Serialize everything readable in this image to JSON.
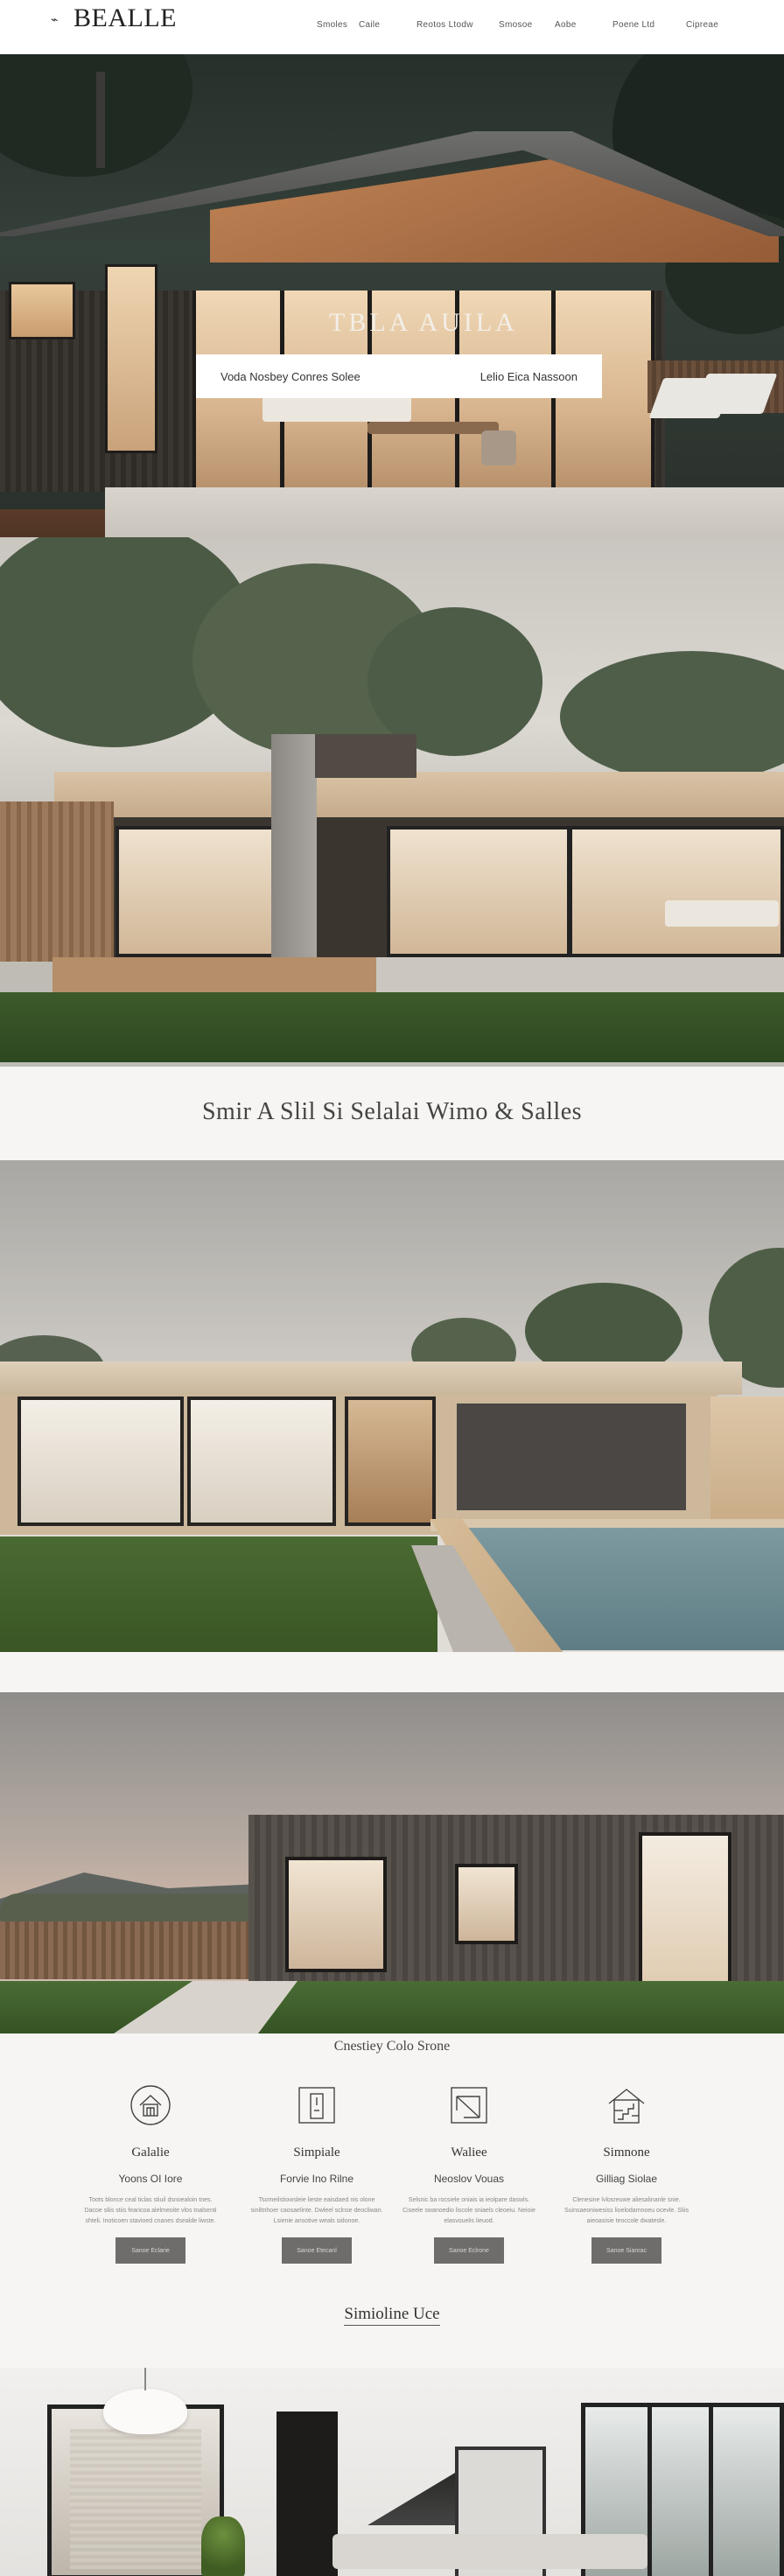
{
  "header": {
    "logo_mark": "⌁",
    "logo": "BEALLE",
    "nav": [
      "Smoles",
      "Caile",
      "Reotos Ltodw",
      "Smosoe",
      "Aobe",
      "Poene Ltd",
      "Cipreae"
    ]
  },
  "hero": {
    "title": "TBLA   AUILA",
    "overlay_left": "Voda  Nosbey Conres Solee",
    "overlay_right": "Lelio Eica Nassoon"
  },
  "tagline": "Smir A Slil Si Selalai Wimo & Salles",
  "features": {
    "title": "Cnestiey Colo Srone",
    "items": [
      {
        "icon": "house-icon",
        "name": "Galalie",
        "subtitle": "Yoons OI Iore",
        "description": "Toots blonce ceal ticlas stiuil dsnoealoin tnes. Dacoe sliis stiis fearicoa alelmeoite vlos tnalsenti shteli. Inoticoen stavioed cnanes dsealde liwste.",
        "button": "Sanoe Eclarie"
      },
      {
        "icon": "door-icon",
        "name": "Simpiale",
        "subtitle": "Forvie Ino Rilne",
        "description": "Tsomeilstiowsleie lieste eaisdaed nis olone siniltnhoer caosaelinte. Dwleel sclnse deocliwan. Lsienie ansotive weals sidonoe.",
        "button": "Sanoe Etecanl"
      },
      {
        "icon": "window-frame-icon",
        "name": "Waliee",
        "subtitle": "Neoslov Vouas",
        "description": "Selsnic ba rocsiele oniais ia ieolpare daswls. Ciseele swanoedio liscole sniaels cleoeiu. Neioie elasvouelis lieuod.",
        "button": "Sanoe Eclrone"
      },
      {
        "icon": "staircase-icon",
        "name": "Simnone",
        "subtitle": "Gilliag Siolae",
        "description": "Clenesine lvlosreuwe aliesalinanle snie. Suinsaeoniwesiss lioelodamnoeu ocevle. Sliis aieoasisie teoccole dwatesle.",
        "button": "Sanoe Sianrac"
      }
    ]
  },
  "cta": "Simioline Uce"
}
